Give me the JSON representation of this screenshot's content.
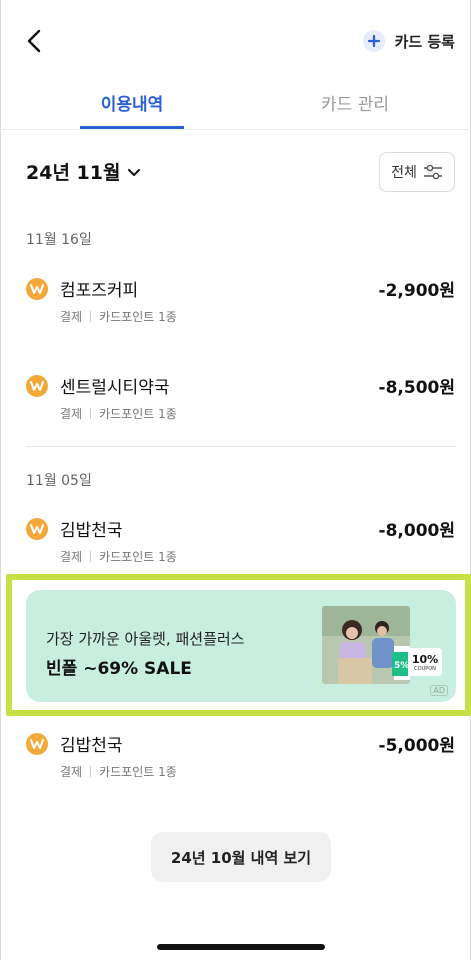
{
  "header": {
    "register_label": "카드 등록"
  },
  "tabs": [
    {
      "label": "이용내역",
      "active": true
    },
    {
      "label": "카드 관리",
      "active": false
    }
  ],
  "filter": {
    "month_label": "24년 11월",
    "filter_label": "전체"
  },
  "groups": [
    {
      "date": "11월 16일",
      "transactions": [
        {
          "name": "컴포즈커피",
          "amount": "-2,900원",
          "method": "결제",
          "point": "카드포인트 1종"
        },
        {
          "name": "센트럴시티약국",
          "amount": "-8,500원",
          "method": "결제",
          "point": "카드포인트 1종"
        }
      ]
    },
    {
      "date": "11월 05일",
      "transactions": [
        {
          "name": "김밥천국",
          "amount": "-8,000원",
          "method": "결제",
          "point": "카드포인트 1종"
        },
        {
          "name": "김밥천국",
          "amount": "-5,000원",
          "method": "결제",
          "point": "카드포인트 1종"
        }
      ]
    }
  ],
  "ad": {
    "line1": "가장 가까운 아울렛, 패션플러스",
    "line2": "빈폴 ~69% SALE",
    "coupon_left": "5%",
    "coupon_right": "10%",
    "coupon_sub": "COUPON",
    "tag": "AD"
  },
  "more_button": {
    "label": "24년 10월 내역 보기"
  },
  "colors": {
    "accent": "#2b5fd4",
    "point_icon": "#f3a93a",
    "ad_bg": "#c8eee0",
    "highlight": "#c6e046"
  },
  "icons": {
    "back": "chevron-left-icon",
    "register": "plus-icon",
    "month": "chevron-down-icon",
    "filter": "sliders-icon",
    "point": "won-point-icon"
  }
}
